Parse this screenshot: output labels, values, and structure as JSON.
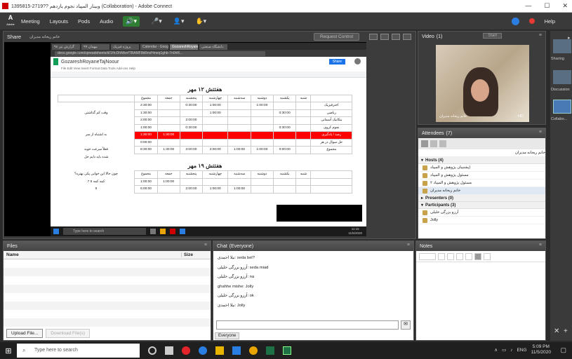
{
  "window": {
    "title": "1395815-2719??  وبینار المپیاد نجوم یازدهم (Collaboration) - Adobe Connect",
    "controls": [
      "—",
      "☐",
      "✕"
    ]
  },
  "menubar": {
    "logo_line1": "Adobe",
    "items": [
      "Meeting",
      "Layouts",
      "Pods",
      "Audio"
    ],
    "help": "Help"
  },
  "share_pod": {
    "label": "Share",
    "presenter": "خانم ریحانه مدیران",
    "request_control": "Request Control"
  },
  "browser": {
    "tabs": [
      "گزارش تیر ۹۸",
      "مهمان ۹۹",
      "پروژه فیزیک",
      "Calendar - Google",
      "GozareshRoyaneh",
      "دانشگاه صنعتی"
    ],
    "url": "docs.google.com/spreadsheets/d/1HcDhNfsnfTBAMF9bRnxHmeq1ghb-7n0hR...",
    "doc_title": "GozareshRoyaneTajNoour",
    "doc_menu": "File  Edit  View  Insert  Format  Data  Tools  Add-ons  Help",
    "share_btn": "Share"
  },
  "sheet": {
    "week1_title": "هفتتش ۱۲ مهر",
    "week2_title": "هفتتش ۱۹ مهر",
    "days": [
      "شنبه",
      "یکشنبه",
      "دوشنبه",
      "سه‌شنبه",
      "چهارشنبه",
      "پنجشنبه",
      "جمعه",
      "مجموع"
    ],
    "rows": [
      {
        "label": "اخترفیزیک",
        "vals": [
          "",
          "1:00:00",
          "",
          "1:00:00",
          "0:30:00",
          "",
          "2:30:00"
        ],
        "note": "",
        "red": false
      },
      {
        "label": "ریاضی",
        "vals": [
          "0:30:00",
          "",
          "",
          "1:00:00",
          "",
          "",
          "1:30:00"
        ],
        "note": "وقت کم گذاشتی",
        "red": false
      },
      {
        "label": "مکانیک آسمانی",
        "vals": [
          "",
          "",
          "",
          "",
          "2:00:00",
          "",
          "2:00:00"
        ],
        "note": "",
        "red": false
      },
      {
        "label": "نجوم کروی",
        "vals": [
          "0:30:00",
          "",
          "",
          "",
          "0:30:00",
          "",
          "1:00:00"
        ],
        "note": "",
        "red": false
      },
      {
        "label": "رصد / یادگیری",
        "vals": [
          "",
          "",
          "",
          "",
          "",
          "1:30:00",
          "1:30:00"
        ],
        "note": "به اشتباه از سر",
        "red": true
      },
      {
        "label": "حل سوال در هر",
        "vals": [
          "",
          "",
          "",
          "",
          "",
          "",
          "0:00:00"
        ],
        "note": "",
        "red": false
      },
      {
        "label": "مجموع",
        "vals": [
          "0:00:00",
          "1:00:00",
          "1:00:00",
          "2:00:00",
          "3:00:00",
          "1:30:00",
          "8:30:00"
        ],
        "note": "فعلاً سرعت خوبه",
        "red": false
      }
    ],
    "week2_note": "شده باید دایم حل",
    "week2_rows": [
      {
        "label": "",
        "vals": [
          "",
          "",
          "",
          "",
          "",
          "1:00:00",
          "1:00:00"
        ],
        "note": "کمه کمه",
        "extra": [
          "5",
          "7"
        ]
      },
      {
        "label": "",
        "vals": [
          "",
          "",
          "1:00:00",
          "1:00:00",
          "2:00:00",
          "",
          "5:00:00"
        ],
        "note": "",
        "extra": [
          "5",
          ""
        ]
      }
    ],
    "week2_question": "چون حالا این خوابی پکی بهتره؟"
  },
  "win_taskbar": {
    "search": "Type here to search",
    "clock_time": "11:15",
    "clock_date": "11/5/2020"
  },
  "video_pod": {
    "label": "Video",
    "count": "(1)",
    "start_label": "Start",
    "speaker": "خانم ریحانه مدیران",
    "hd": "HD"
  },
  "attendees_pod": {
    "label": "Attendees",
    "count": "(7)",
    "me": "خانم ریحانه مدیران",
    "hosts_label": "Hosts (4)",
    "hosts": [
      "پشتیبان پژوهش و المپیاد)",
      "مسئول پژوهش و المپیاد",
      "مسئول پژوهش و المپیاد ۲",
      "خانم ریحانه مدیران"
    ],
    "presenters_label": "Presenters (0)",
    "participants_label": "Participants (3)",
    "participants": [
      "آرزو بزرگی خلیلی",
      "Jolly"
    ]
  },
  "files_pod": {
    "label": "Files",
    "col_name": "Name",
    "col_size": "Size",
    "upload": "Upload File...",
    "download": "Download File(s)"
  },
  "chat_pod": {
    "label": "Chat",
    "scope": "(Everyone)",
    "messages": [
      "نیلا احمدی: seda bel?",
      "آرزو بزرگی خلیلی: seda miad",
      "آرزو بزرگی خلیلی: na",
      "ghahhe mishe: Jolly",
      "آرزو بزرگی خلیلی: ok",
      "نیلا احمدی: Jolly"
    ],
    "tab": "Everyone"
  },
  "notes_pod": {
    "label": "Notes"
  },
  "right_panel": {
    "sharing": "Sharing",
    "discussion": "Discussion",
    "collab": "Collabo..."
  },
  "os_taskbar": {
    "search": "Type here to search",
    "lang": "ENG",
    "time": "5:09 PM",
    "date": "11/5/2020"
  }
}
